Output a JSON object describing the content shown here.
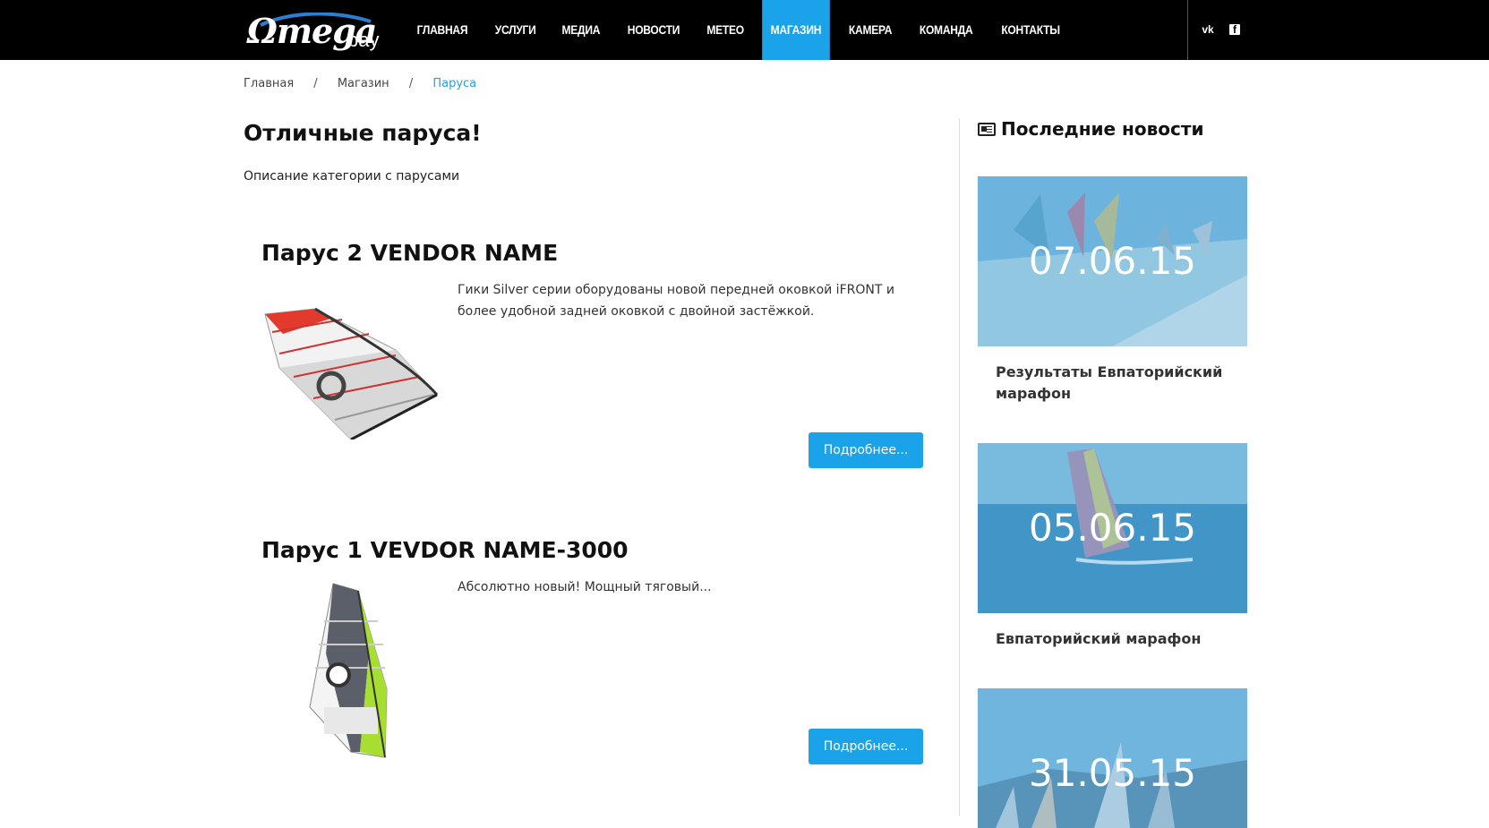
{
  "header": {
    "logo": {
      "main": "Ωmega",
      "suffix": "bay"
    },
    "nav": [
      "ГЛАВНАЯ",
      "УСЛУГИ",
      "МЕДИА",
      "НОВОСТИ",
      "МЕТЕО",
      "МАГАЗИН",
      "КАМЕРА",
      "КОМАНДА",
      "КОНТАКТЫ"
    ],
    "active_nav": "МАГАЗИН",
    "social": {
      "vk": "vk",
      "facebook": "f"
    }
  },
  "breadcrumb": {
    "items": [
      "Главная",
      "Магазин",
      "Паруса"
    ],
    "separator": "/"
  },
  "category": {
    "title": "Отличные паруса!",
    "description": "Описание категории с парусами"
  },
  "products": [
    {
      "title": "Парус 2 VENDOR NAME",
      "text": "Гики Silver серии оборудованы новой передней оковкой iFRONT и более удобной задней оковкой с двойной застёжкой.",
      "button": "Подробнее..."
    },
    {
      "title": "Парус 1 VEVDOR NAME-3000",
      "text": "Абсолютно новый! Мощный тяговый...",
      "button": "Подробнее..."
    }
  ],
  "sidebar": {
    "title": "Последние новости",
    "news": [
      {
        "date": "07.06.15",
        "title": "Результаты Евпаторийский марафон"
      },
      {
        "date": "05.06.15",
        "title": "Евпаторийский марафон"
      },
      {
        "date": "31.05.15",
        "title": ""
      }
    ]
  },
  "colors": {
    "accent": "#1aa3e8",
    "header_bg": "#000000"
  }
}
